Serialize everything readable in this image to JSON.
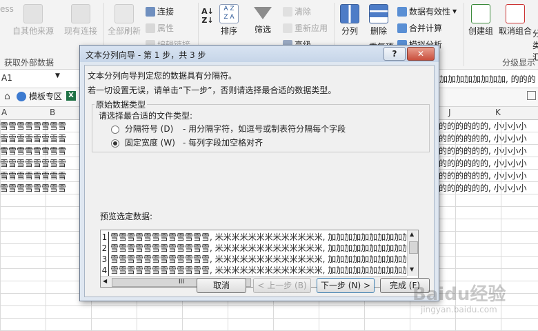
{
  "ribbon": {
    "left_partial_text": "ess",
    "from_other_sources": "自其他来源",
    "existing_connections": "现有连接",
    "refresh_all": "全部刷新",
    "connections": "连接",
    "properties": "属性",
    "edit_links": "编辑链接",
    "group_external": "获取外部数据",
    "sort_label": "排序",
    "filter_label": "筛选",
    "clear": "清除",
    "reapply": "重新应用",
    "advanced": "高级",
    "text_to_columns": "分列",
    "remove_duplicates": "删除",
    "remove_dup_line2": "重复项",
    "data_validation": "数据有效性",
    "consolidate": "合并计算",
    "what_if": "模拟分析",
    "group": "创建组",
    "ungroup": "取消组合",
    "subtotal": "分类汇",
    "group_outline": "分级显示"
  },
  "formula_bar": {
    "name_box": "A1",
    "formula_text": "加加加加加加加加, 的的的"
  },
  "tabs": {
    "template_tab": "模板专区"
  },
  "columns": {
    "a": "A",
    "b": "B",
    "j": "J",
    "k": "K"
  },
  "sheet": {
    "left_cells": "雪雪雪雪雪雪雪雪",
    "right_cells": "的的的的的的, 小小小小"
  },
  "dialog": {
    "title": "文本分列向导 - 第 1 步，共 3 步",
    "help": "?",
    "intro": "文本分列向导判定您的数据具有分隔符。",
    "instruction": "若一切设置无误，请单击“下一步”，否则请选择最合适的数据类型。",
    "section_title": "原始数据类型",
    "choose_type": "请选择最合适的文件类型:",
    "option_delimited": "分隔符号 (D)",
    "option_delimited_desc": "- 用分隔字符，如逗号或制表符分隔每个字段",
    "option_fixed": "固定宽度 (W)",
    "option_fixed_desc": "- 每列字段加空格对齐",
    "preview_label": "预览选定数据:",
    "preview_rows": [
      {
        "num": "1",
        "text": "雪雪雪雪雪雪雪雪雪雪雪雪, 米米米米米米米米米米米米米, 加加加加加加加加加加加加加"
      },
      {
        "num": "2",
        "text": "雪雪雪雪雪雪雪雪雪雪雪雪, 米米米米米米米米米米米米米, 加加加加加加加加加加加加加"
      },
      {
        "num": "3",
        "text": "雪雪雪雪雪雪雪雪雪雪雪雪, 米米米米米米米米米米米米米, 加加加加加加加加加加加加加"
      },
      {
        "num": "4",
        "text": "雪雪雪雪雪雪雪雪雪雪雪雪, 米米米米米米米米米米米米米, 加加加加加加加加加加加加加"
      }
    ],
    "hscroll_grip": "III",
    "cancel": "取消",
    "back": "< 上一步 (B)",
    "next": "下一步 (N) >",
    "finish": "完成 (F)"
  },
  "watermark": {
    "brand": "Baidu经验",
    "url": "jingyan.baidu.com"
  },
  "colors": {
    "accent_blue": "#2b5797",
    "dialog_frame": "#6d7c92"
  }
}
